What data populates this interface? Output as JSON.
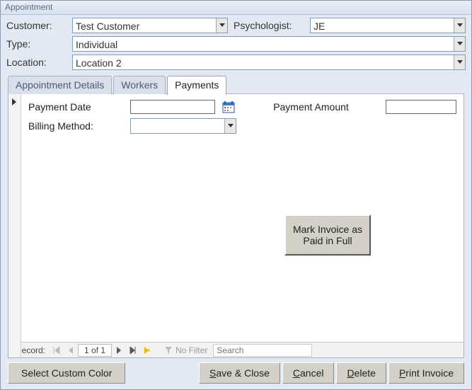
{
  "window": {
    "title": "Appointment"
  },
  "header": {
    "customer_label": "Customer:",
    "customer_value": "Test Customer",
    "psychologist_label": "Psychologist:",
    "psychologist_value": "JE",
    "type_label": "Type:",
    "type_value": "Individual",
    "location_label": "Location:",
    "location_value": "Location 2"
  },
  "tabs": {
    "details": "Appointment Details",
    "workers": "Workers",
    "payments": "Payments",
    "active": "payments"
  },
  "payments": {
    "payment_date_label": "Payment Date",
    "payment_date_value": "",
    "payment_amount_label": "Payment Amount",
    "payment_amount_value": "",
    "billing_method_label": "Billing Method:",
    "billing_method_value": "",
    "mark_paid_label": "Mark Invoice as Paid in Full"
  },
  "nav": {
    "record_label": "Record:",
    "current": "1 of 1",
    "no_filter": "No Filter",
    "search_placeholder": "Search"
  },
  "footer": {
    "select_color": "Select Custom Color",
    "save_close": "Save & Close",
    "cancel": "Cancel",
    "delete": "Delete",
    "print_invoice": "Print Invoice"
  }
}
